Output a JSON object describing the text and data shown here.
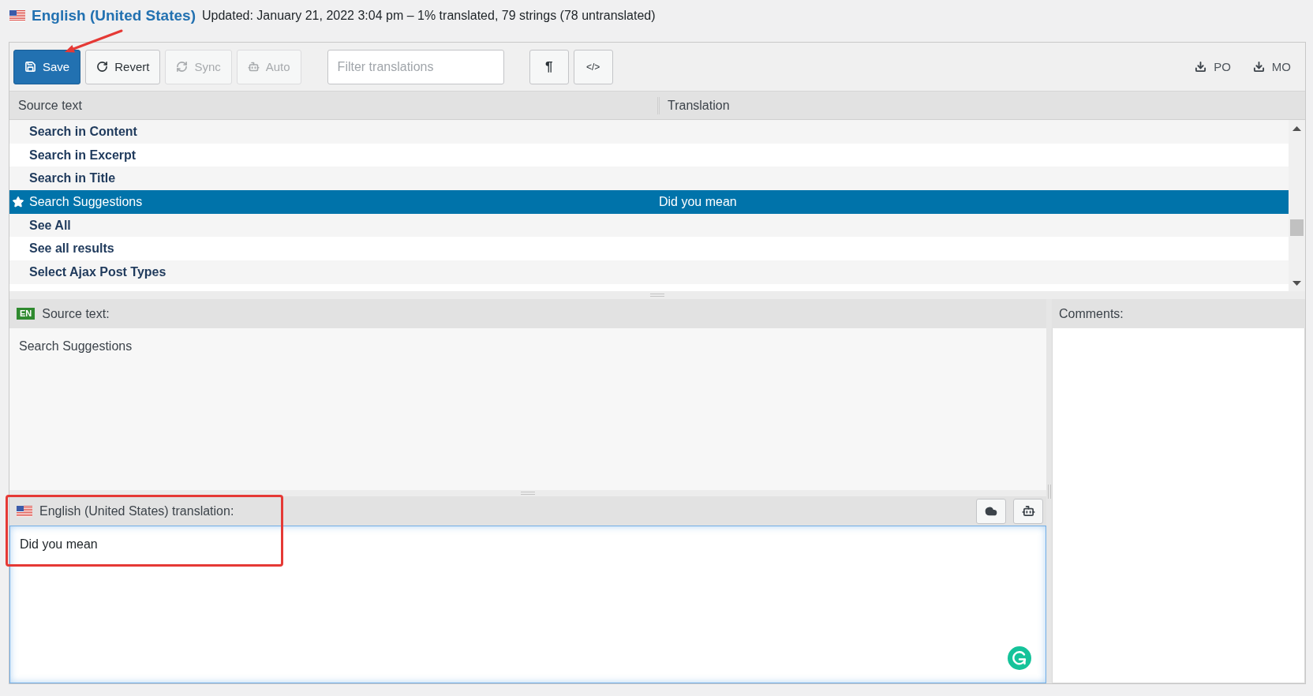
{
  "header": {
    "title": "English (United States)",
    "meta": "Updated: January 21, 2022 3:04 pm – 1% translated, 79 strings (78 untranslated)"
  },
  "toolbar": {
    "buttons": [
      {
        "kind": "save",
        "label": "Save",
        "primary": true,
        "disabled": false
      },
      {
        "kind": "revert",
        "label": "Revert",
        "primary": false,
        "disabled": false
      },
      {
        "kind": "sync",
        "label": "Sync",
        "primary": false,
        "disabled": true
      },
      {
        "kind": "auto",
        "label": "Auto",
        "primary": false,
        "disabled": true
      }
    ],
    "filter": {
      "placeholder": "Filter translations"
    },
    "toggles": [
      {
        "kind": "pilcrow",
        "label": "¶"
      },
      {
        "kind": "code",
        "label": "</>"
      }
    ],
    "downloads": [
      {
        "label": "PO"
      },
      {
        "label": "MO"
      }
    ]
  },
  "table": {
    "columns": [
      {
        "label": "Source text"
      },
      {
        "label": "Translation"
      }
    ],
    "rows": [
      {
        "source": "Search in Content",
        "translated": false,
        "starred": false,
        "selected": false
      },
      {
        "source": "Search in Excerpt",
        "translated": false,
        "starred": false,
        "selected": false
      },
      {
        "source": "Search in Title",
        "translated": false,
        "starred": false,
        "selected": false
      },
      {
        "source": "Search Suggestions",
        "translation": "Did you mean",
        "translated": true,
        "starred": true,
        "selected": true
      },
      {
        "source": "See All",
        "translated": false,
        "starred": false,
        "selected": false
      },
      {
        "source": "See all results",
        "translated": false,
        "starred": false,
        "selected": false
      },
      {
        "source": "Select Ajax Post Types",
        "translated": false,
        "starred": false,
        "selected": false
      }
    ]
  },
  "source_pane": {
    "badge": "EN",
    "title": "Source text:",
    "text": "Search Suggestions"
  },
  "translation_pane": {
    "title": "English (United States) translation:",
    "value": "Did you mean"
  },
  "comments_pane": {
    "title": "Comments:"
  }
}
